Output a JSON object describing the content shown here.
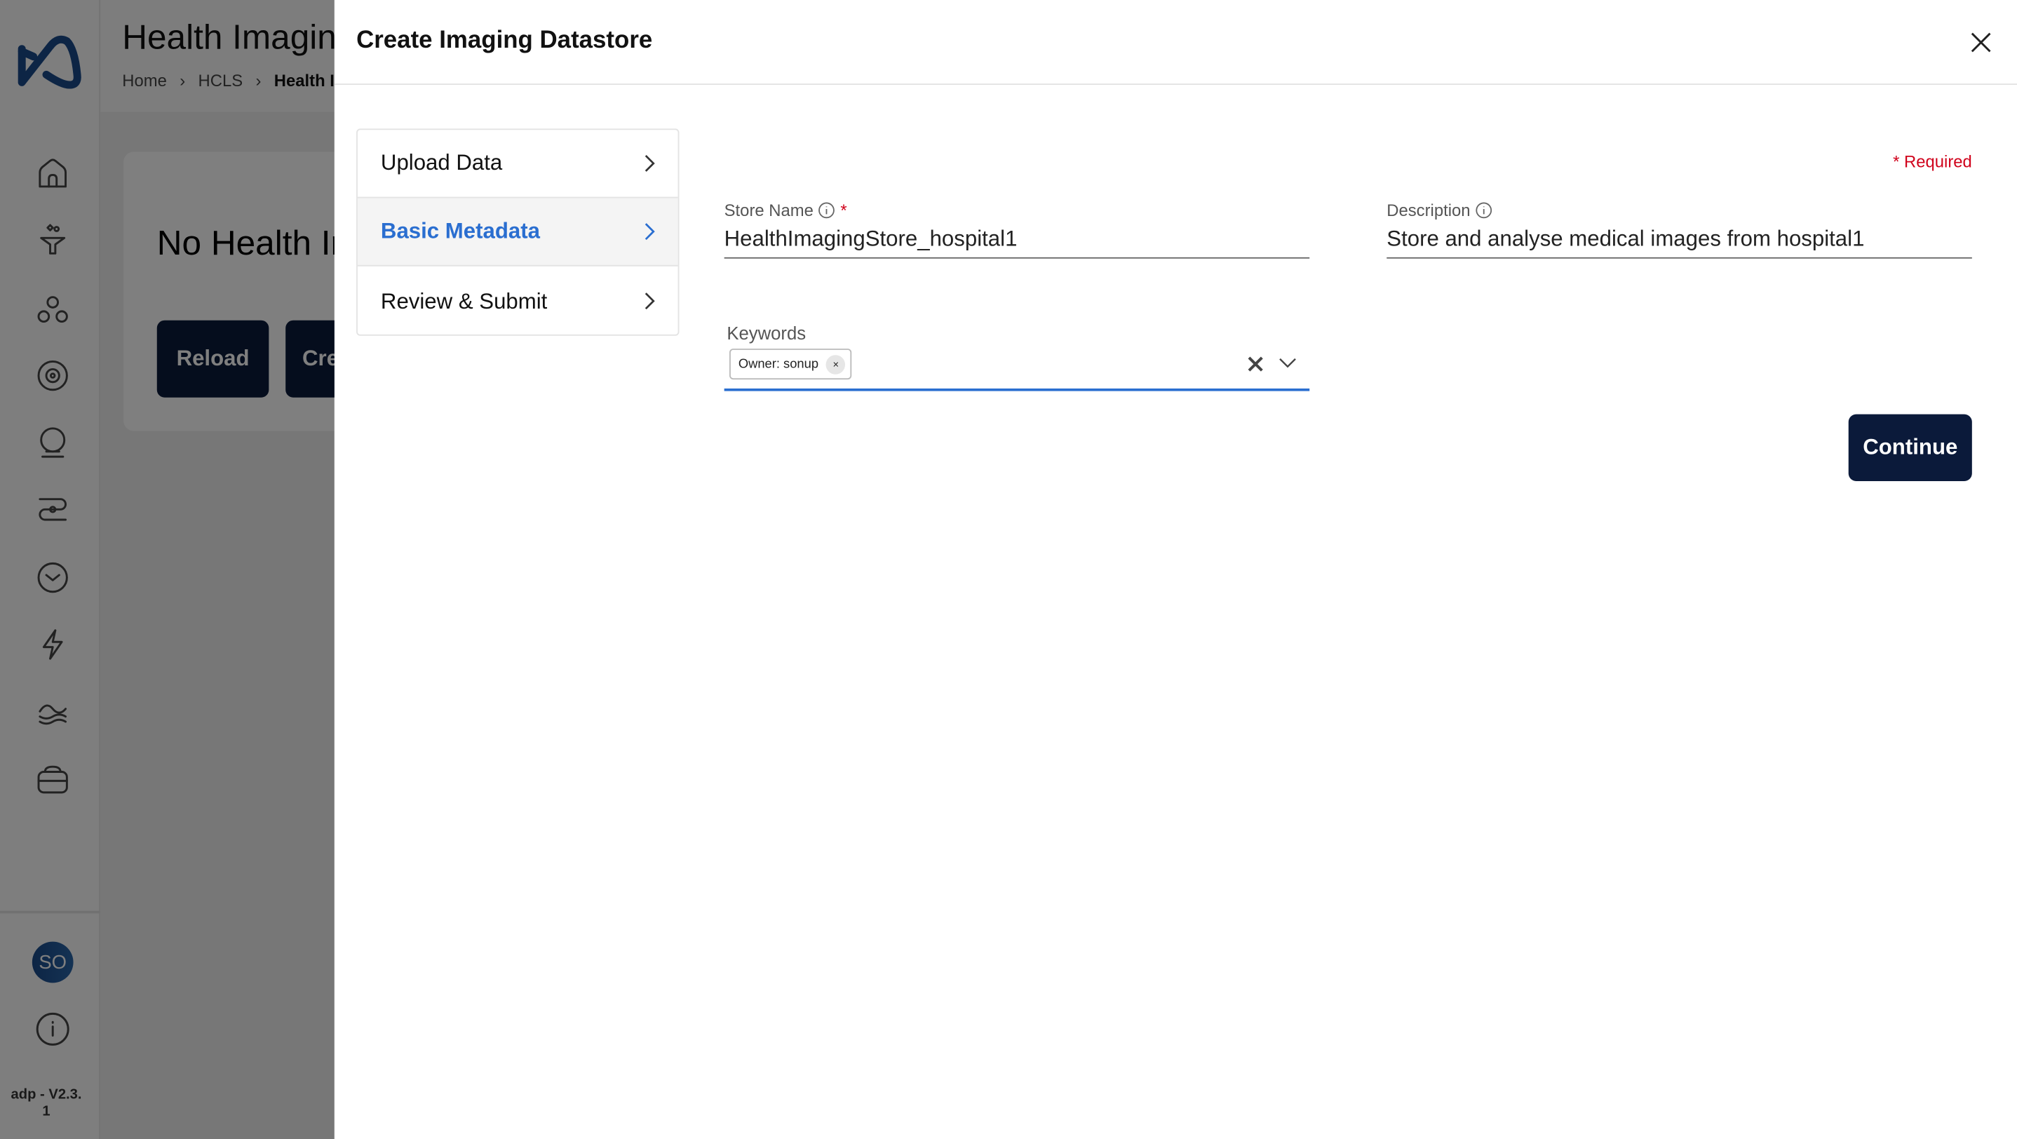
{
  "background": {
    "page_title": "Health Imaging",
    "breadcrumb": [
      "Home",
      "HCLS",
      "Health Im"
    ],
    "empty_title": "No Health Ir",
    "reload_label": "Reload",
    "create_label": "Cre"
  },
  "sidebar": {
    "icons": [
      "home-icon",
      "funnel-icon",
      "hierarchy-icon",
      "settings-cycle-icon",
      "bulb-icon",
      "workflow-icon",
      "clock-icon",
      "bolt-icon",
      "data-lake-icon",
      "storage-icon"
    ],
    "avatar": "SO",
    "version": "adp - V2.3.",
    "version_line2": "1"
  },
  "drawer": {
    "title": "Create Imaging Datastore",
    "steps": [
      {
        "label": "Upload Data",
        "active": false
      },
      {
        "label": "Basic Metadata",
        "active": true
      },
      {
        "label": "Review & Submit",
        "active": false
      }
    ],
    "required_note": "* Required",
    "store_name": {
      "label": "Store Name",
      "value": "HealthImagingStore_hospital1",
      "required_mark": "*"
    },
    "description": {
      "label": "Description",
      "value": "Store and analyse medical images from hospital1"
    },
    "keywords": {
      "label": "Keywords",
      "chips": [
        "Owner: sonup"
      ]
    },
    "continue_label": "Continue"
  },
  "colors": {
    "accent": "#2a6ed0",
    "primary_button": "#0b1a3a",
    "required": "#d0021b",
    "logo": "#1a4a8a"
  }
}
